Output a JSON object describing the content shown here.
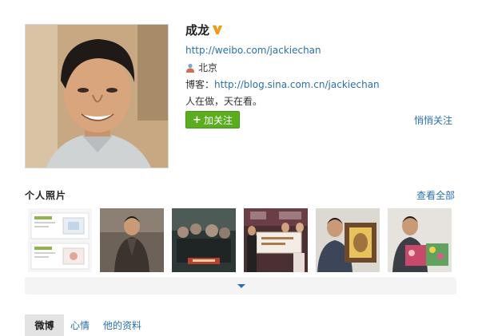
{
  "profile": {
    "name": "成龙",
    "verified_icon": "verified-v-badge",
    "weibo_url": "http://weibo.com/jackiechan",
    "location": "北京",
    "blog_label": "博客：",
    "blog_url": "http://blog.sina.com.cn/jackiechan",
    "motto": "人在做，天在看。"
  },
  "actions": {
    "follow_plus": "+",
    "follow_label": "加关注",
    "quiet_follow_label": "悄悄关注"
  },
  "photos_section": {
    "title": "个人照片",
    "see_all_label": "查看全部"
  },
  "tabs": [
    {
      "label": "微博",
      "active": true
    },
    {
      "label": "心情",
      "active": false
    },
    {
      "label": "他的资料",
      "active": false
    }
  ],
  "colors": {
    "link": "#2a6fb1",
    "follow_button": "#5aad1d",
    "verified": "#f39c12",
    "tab_active_bg": "#e3e3e3"
  }
}
